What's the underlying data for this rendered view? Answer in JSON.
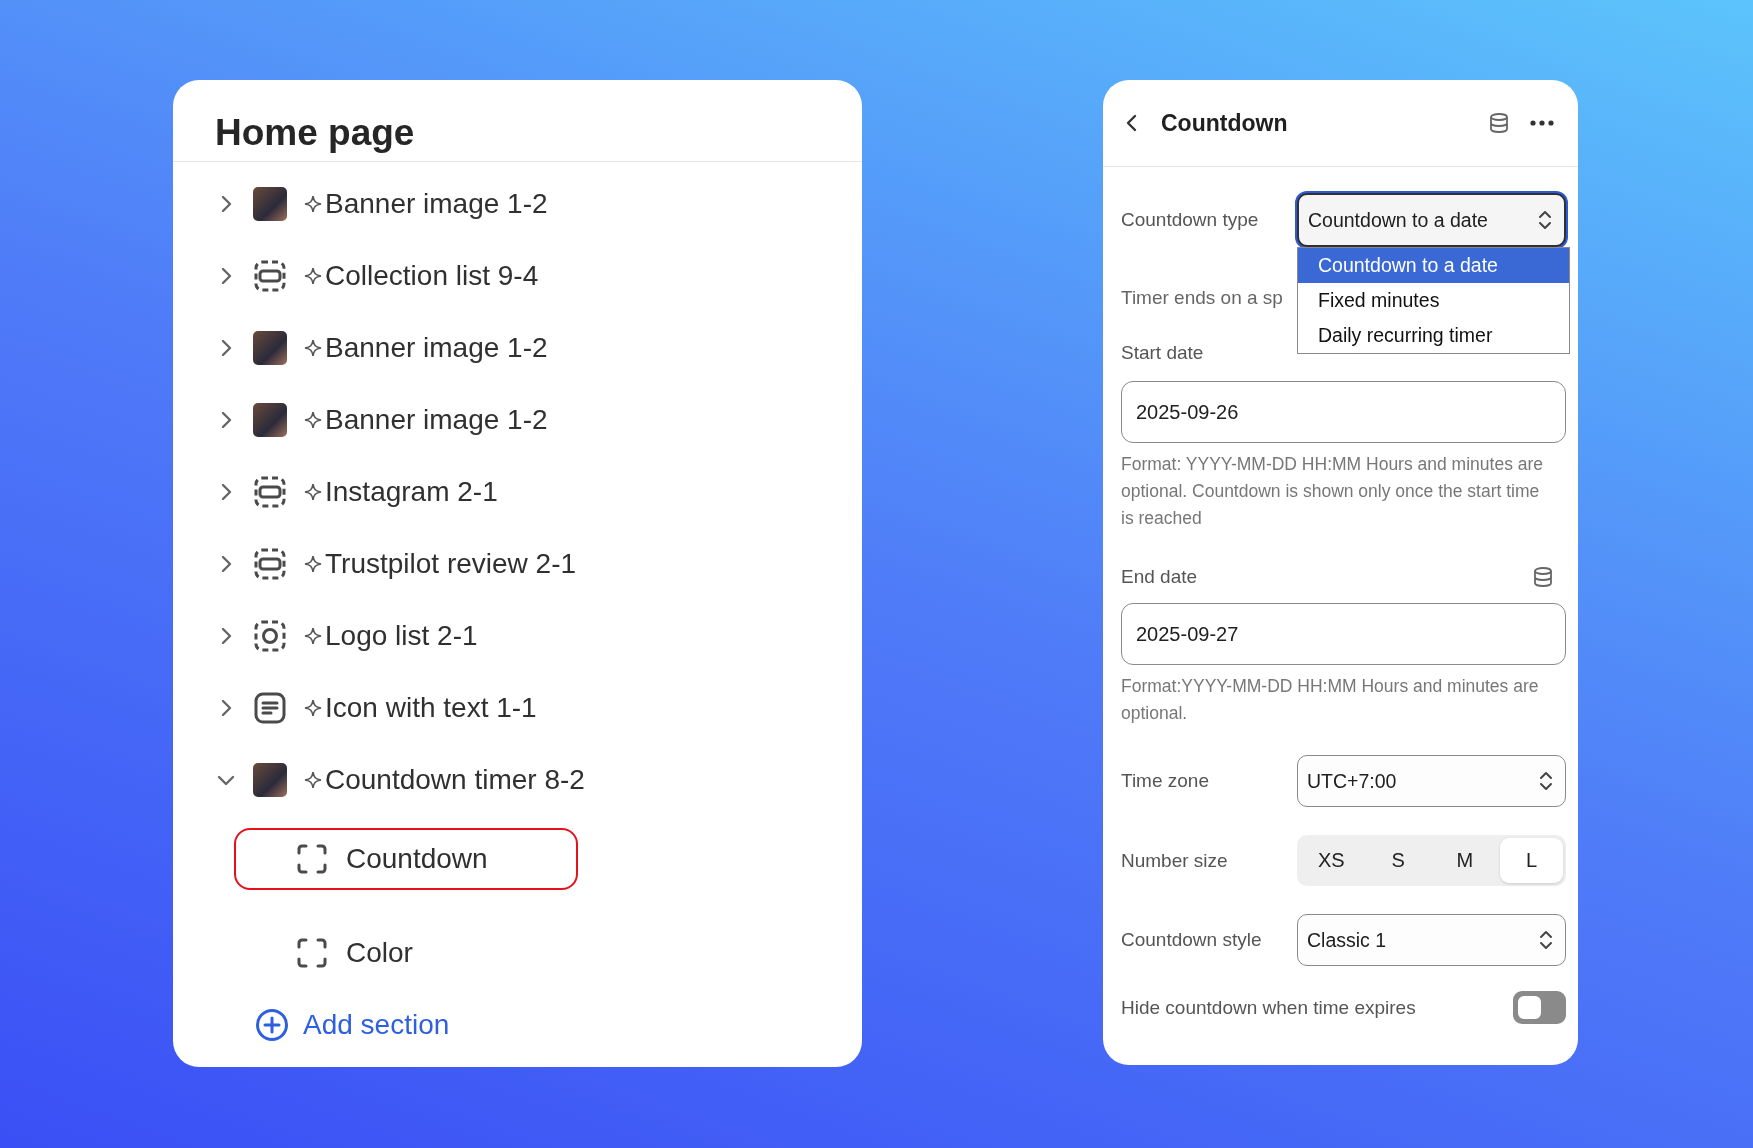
{
  "left_panel": {
    "title": "Home page",
    "sections": [
      {
        "name": "Banner image 1-2",
        "kind": "photo",
        "expanded": false
      },
      {
        "name": "Collection list 9-4",
        "kind": "section",
        "expanded": false
      },
      {
        "name": "Banner image 1-2",
        "kind": "photo",
        "expanded": false
      },
      {
        "name": "Banner image 1-2",
        "kind": "photo",
        "expanded": false
      },
      {
        "name": "Instagram 2-1",
        "kind": "section",
        "expanded": false
      },
      {
        "name": "Trustpilot review 2-1",
        "kind": "section",
        "expanded": false
      },
      {
        "name": "Logo list 2-1",
        "kind": "logo",
        "expanded": false
      },
      {
        "name": "Icon with text 1-1",
        "kind": "text",
        "expanded": false
      },
      {
        "name": "Countdown timer 8-2",
        "kind": "photo",
        "expanded": true,
        "children": [
          {
            "name": "Countdown",
            "selected": true
          },
          {
            "name": "Color",
            "selected": false
          }
        ]
      }
    ],
    "add_section": "Add section"
  },
  "right_panel": {
    "title": "Countdown",
    "countdown_type": {
      "label": "Countdown type",
      "value": "Countdown to a date",
      "open": true,
      "options": [
        {
          "label": "Countdown to a date",
          "selected": true
        },
        {
          "label": "Fixed minutes",
          "selected": false
        },
        {
          "label": "Daily recurring timer",
          "selected": false
        }
      ]
    },
    "type_description": "Timer ends on a sp",
    "start_date": {
      "label": "Start date",
      "value": "2025-09-26",
      "help": "Format: YYYY-MM-DD HH:MM Hours and minutes are optional. Countdown is shown only once the start time is reached"
    },
    "end_date": {
      "label": "End date",
      "value": "2025-09-27",
      "help": "Format:YYYY-MM-DD HH:MM Hours and minutes are optional."
    },
    "time_zone": {
      "label": "Time zone",
      "value": "UTC+7:00"
    },
    "number_size": {
      "label": "Number size",
      "options": [
        {
          "label": "XS",
          "selected": false
        },
        {
          "label": "S",
          "selected": false
        },
        {
          "label": "M",
          "selected": false
        },
        {
          "label": "L",
          "selected": true
        }
      ]
    },
    "countdown_style": {
      "label": "Countdown style",
      "value": "Classic 1"
    },
    "hide_when_expired": {
      "label": "Hide countdown when time expires",
      "on": false
    }
  }
}
